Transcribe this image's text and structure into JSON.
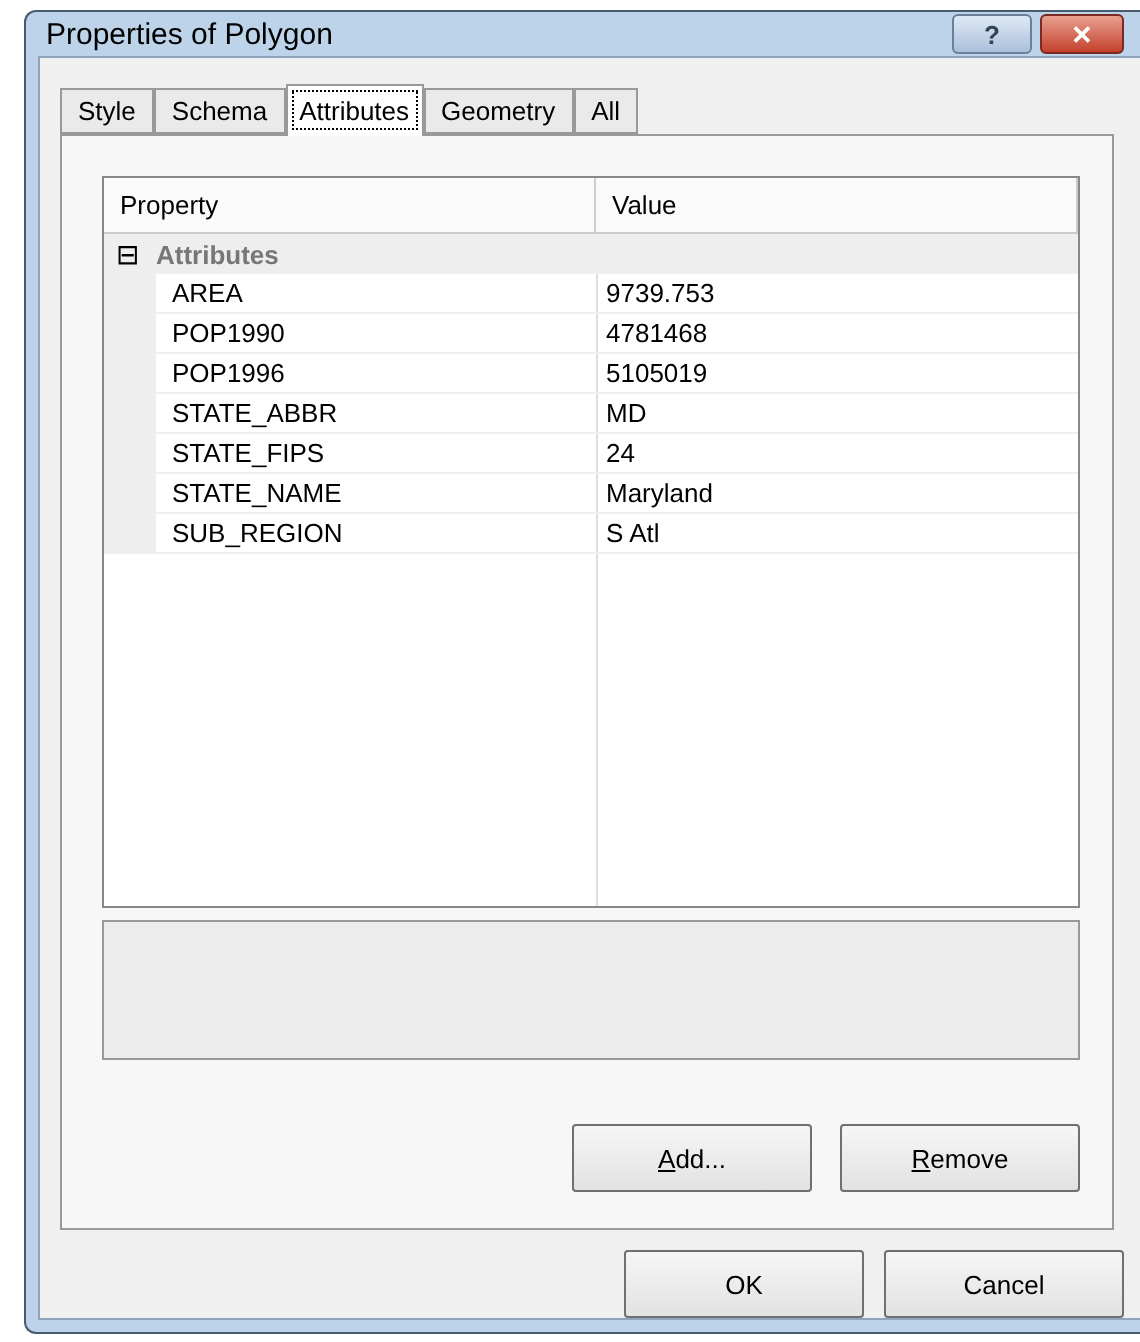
{
  "window": {
    "title": "Properties of Polygon"
  },
  "title_buttons": [
    {
      "kind": "help",
      "label": "?"
    },
    {
      "kind": "close",
      "label": "✕"
    }
  ],
  "tabs": [
    {
      "label": "Style",
      "selected": false
    },
    {
      "label": "Schema",
      "selected": false
    },
    {
      "label": "Attributes",
      "selected": true
    },
    {
      "label": "Geometry",
      "selected": false
    },
    {
      "label": "All",
      "selected": false
    }
  ],
  "grid": {
    "columns": [
      "Property",
      "Value"
    ],
    "category": {
      "label": "Attributes",
      "expanded": true,
      "toggle": "⊟"
    },
    "rows": [
      {
        "property": "AREA",
        "value": "9739.753"
      },
      {
        "property": "POP1990",
        "value": "4781468"
      },
      {
        "property": "POP1996",
        "value": "5105019"
      },
      {
        "property": "STATE_ABBR",
        "value": "MD"
      },
      {
        "property": "STATE_FIPS",
        "value": "24"
      },
      {
        "property": "STATE_NAME",
        "value": "Maryland"
      },
      {
        "property": "SUB_REGION",
        "value": "S Atl"
      }
    ]
  },
  "panel_buttons": [
    "Add...",
    "Remove"
  ],
  "dialog_buttons": [
    "OK",
    "Cancel"
  ]
}
